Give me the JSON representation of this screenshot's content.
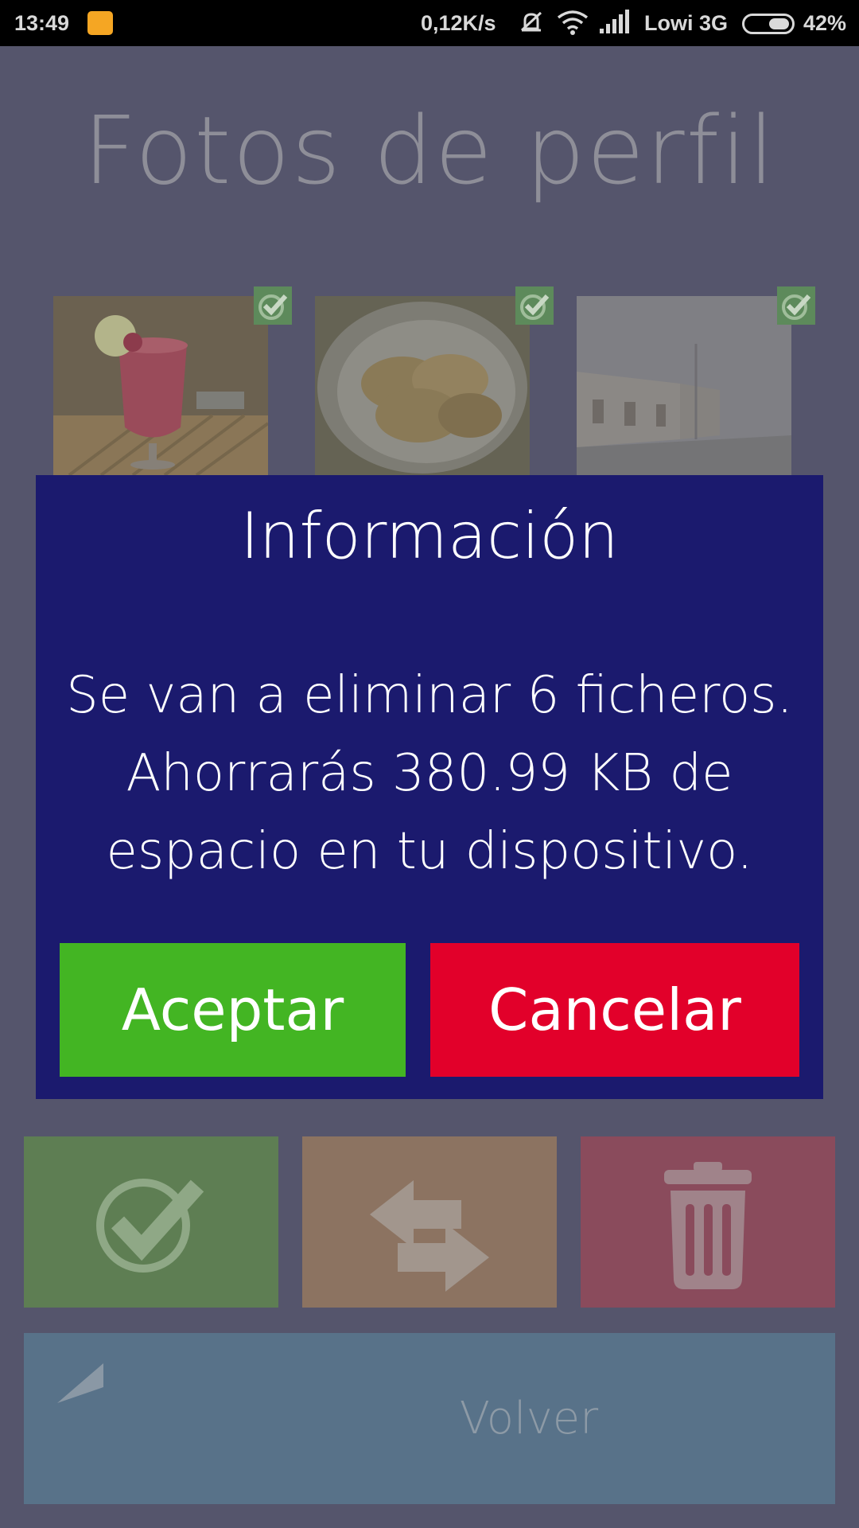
{
  "status_bar": {
    "time": "13:49",
    "network_speed": "0,12K/s",
    "carrier": "Lowi 3G",
    "battery_percent": "42%",
    "battery_level": 0.42,
    "icons": [
      "notification-icon",
      "mute-icon",
      "wifi-icon",
      "signal-icon",
      "battery-icon"
    ]
  },
  "page": {
    "title": "Fotos de perfil"
  },
  "thumbnails": [
    {
      "subject": "red cocktail drink",
      "selected": true
    },
    {
      "subject": "plate of pancakes",
      "selected": true
    },
    {
      "subject": "foggy street with houses",
      "selected": true
    }
  ],
  "dialog": {
    "title": "Información",
    "message_lines": [
      "Se van a eliminar 6 ficheros.",
      "Ahorrarás 380.99 KB de",
      "espacio en tu dispositivo."
    ],
    "accept_label": "Aceptar",
    "cancel_label": "Cancelar"
  },
  "actions": {
    "select_icon": "check-circle-icon",
    "swap_icon": "swap-arrows-icon",
    "delete_icon": "trash-icon",
    "back_label": "Volver",
    "back_icon": "back-arrow-icon"
  },
  "colors": {
    "overlay_background": "#55556c",
    "dialog_background": "#1b1a6e",
    "accept": "#43b523",
    "cancel": "#e2002a"
  }
}
